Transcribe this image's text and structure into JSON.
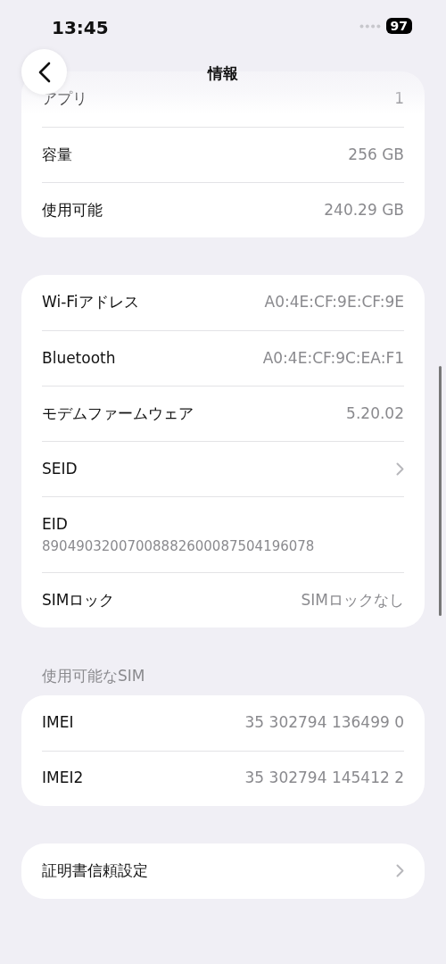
{
  "status_bar": {
    "time": "13:45",
    "battery": "97"
  },
  "nav": {
    "title": "情報"
  },
  "groups": [
    {
      "rows": [
        {
          "kind": "value",
          "label": "アプリ",
          "value": "1"
        },
        {
          "kind": "value",
          "label": "容量",
          "value": "256 GB"
        },
        {
          "kind": "value",
          "label": "使用可能",
          "value": "240.29 GB"
        }
      ]
    },
    {
      "rows": [
        {
          "kind": "value",
          "label": "Wi-Fiアドレス",
          "value": "A0:4E:CF:9E:CF:9E"
        },
        {
          "kind": "value",
          "label": "Bluetooth",
          "value": "A0:4E:CF:9C:EA:F1"
        },
        {
          "kind": "value",
          "label": "モデムファームウェア",
          "value": "5.20.02"
        },
        {
          "kind": "chevron",
          "label": "SEID"
        },
        {
          "kind": "stacked",
          "label": "EID",
          "value": "89049032007008882600087504196078"
        },
        {
          "kind": "value",
          "label": "SIMロック",
          "value": "SIMロックなし"
        }
      ]
    },
    {
      "header": "使用可能なSIM",
      "rows": [
        {
          "kind": "value",
          "label": "IMEI",
          "value": "35 302794 136499 0"
        },
        {
          "kind": "value",
          "label": "IMEI2",
          "value": "35 302794 145412 2"
        }
      ]
    },
    {
      "rows": [
        {
          "kind": "chevron",
          "label": "証明書信頼設定"
        }
      ]
    }
  ]
}
